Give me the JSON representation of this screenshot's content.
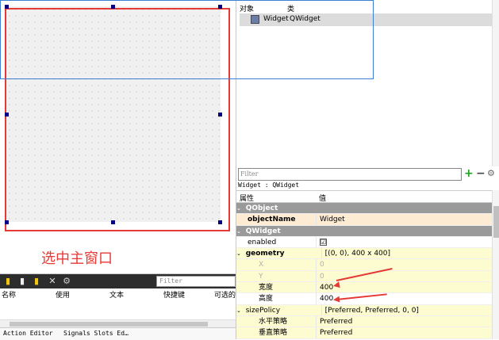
{
  "annotation": {
    "select_main_window": "选中主窗口"
  },
  "object_inspector": {
    "col_object": "对象",
    "col_class": "类",
    "row": {
      "name": "Widget",
      "class": "QWidget",
      "icon": "widget-icon"
    }
  },
  "property_editor": {
    "filter_placeholder": "Filter",
    "class_line": "Widget : QWidget",
    "col_property": "属性",
    "col_value": "值",
    "rows": [
      {
        "key": "QObject",
        "value": "",
        "kind": "category"
      },
      {
        "key": "objectName",
        "value": "Widget",
        "kind": "bold-orange"
      },
      {
        "key": "QWidget",
        "value": "",
        "kind": "category"
      },
      {
        "key": "enabled",
        "value": "☑",
        "kind": "checkbox"
      },
      {
        "key": "geometry",
        "value": "[(0, 0), 400 x 400]",
        "kind": "bold-yellow"
      },
      {
        "key": "X",
        "value": "0",
        "kind": "dim-sub"
      },
      {
        "key": "Y",
        "value": "0",
        "kind": "dim-sub"
      },
      {
        "key": "宽度",
        "value": "400",
        "kind": "sub"
      },
      {
        "key": "高度",
        "value": "400",
        "kind": "sub-white"
      },
      {
        "key": "sizePolicy",
        "value": "[Preferred, Preferred, 0, 0]",
        "kind": "yellow"
      },
      {
        "key": "水平策略",
        "value": "Preferred",
        "kind": "sub"
      },
      {
        "key": "垂直策略",
        "value": "Preferred",
        "kind": "sub"
      }
    ]
  },
  "action_editor": {
    "filter_placeholder": "Filter",
    "columns": [
      "名称",
      "使用",
      "文本",
      "快捷键",
      "可选的"
    ],
    "tabs": [
      "Action Editor",
      "Signals Slots Ed…"
    ]
  },
  "colors": {
    "annotation": "#e53935",
    "selection_border": "#3c7fd3",
    "handle": "#000080"
  }
}
